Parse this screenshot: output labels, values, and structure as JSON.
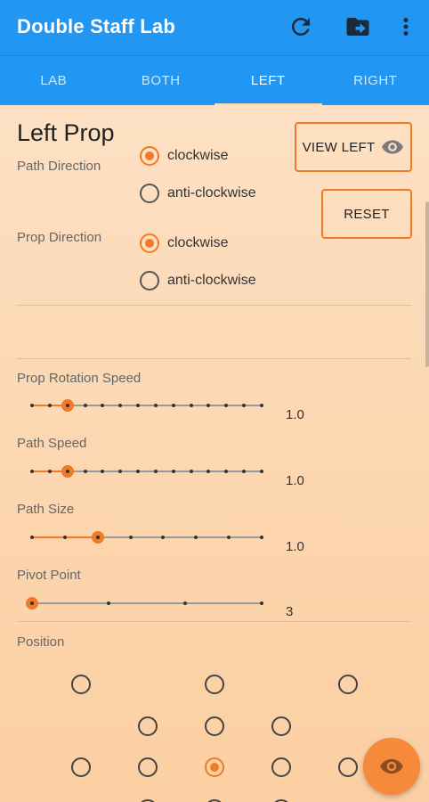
{
  "appbar": {
    "title": "Double Staff Lab",
    "icons": [
      "refresh-icon",
      "folder-export-icon",
      "more-vert-icon"
    ]
  },
  "tabs": [
    {
      "label": "LAB",
      "active": false
    },
    {
      "label": "BOTH",
      "active": false
    },
    {
      "label": "LEFT",
      "active": true
    },
    {
      "label": "RIGHT",
      "active": false
    }
  ],
  "panel": {
    "title": "Left Prop",
    "path_direction": {
      "label": "Path Direction",
      "options": [
        {
          "label": "clockwise",
          "selected": true
        },
        {
          "label": "anti-clockwise",
          "selected": false
        }
      ]
    },
    "prop_direction": {
      "label": "Prop Direction",
      "options": [
        {
          "label": "clockwise",
          "selected": true
        },
        {
          "label": "anti-clockwise",
          "selected": false
        }
      ]
    },
    "view_button": {
      "label": "VIEW LEFT",
      "icon": "eye-icon"
    },
    "reset_button": {
      "label": "RESET"
    }
  },
  "sliders": [
    {
      "label": "Prop Rotation Speed",
      "value": "1.0",
      "steps": 14,
      "position": 2
    },
    {
      "label": "Path Speed",
      "value": "1.0",
      "steps": 14,
      "position": 2
    },
    {
      "label": "Path Size",
      "value": "1.0",
      "steps": 8,
      "position": 2
    },
    {
      "label": "Pivot Point",
      "value": "3",
      "steps": 4,
      "position": 0
    }
  ],
  "position": {
    "label": "Position",
    "selected": "row-3-center"
  },
  "fab": {
    "icon": "eye-icon"
  },
  "colors": {
    "appbar": "#2196f3",
    "accent": "#f07a28",
    "background": "#fbd9b3"
  }
}
